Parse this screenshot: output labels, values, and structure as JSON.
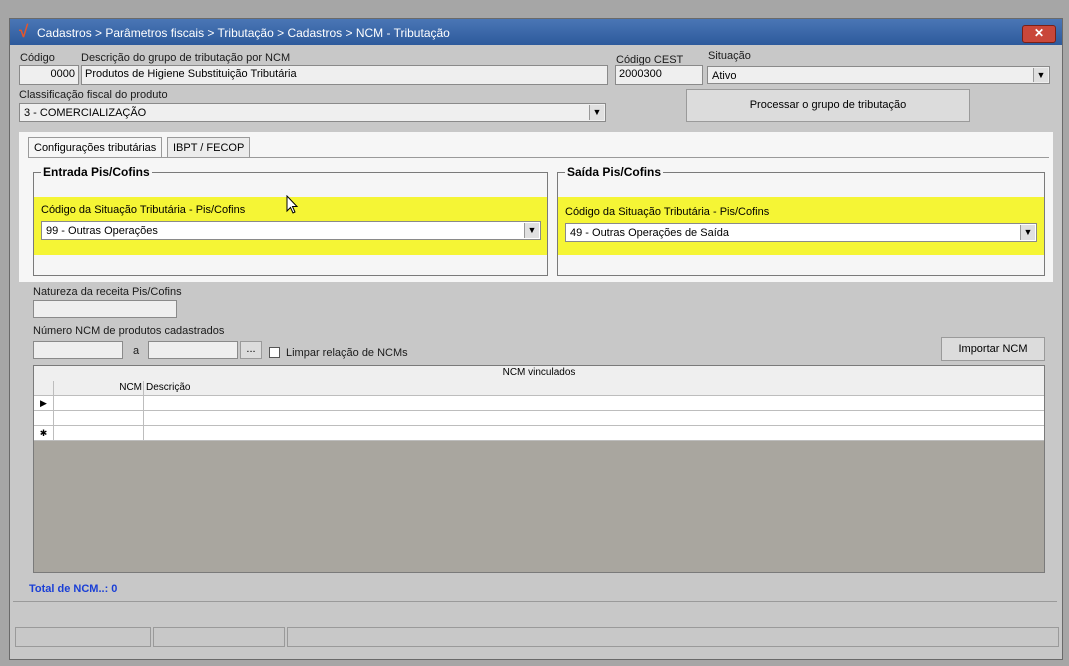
{
  "window": {
    "logo": "√",
    "title": "Cadastros > Parâmetros fiscais > Tributação > Cadastros > NCM - Tributação",
    "close_label": "✕"
  },
  "header": {
    "codigo_label": "Código",
    "codigo_value": "0000",
    "descricao_label": "Descrição do grupo de tributação por NCM",
    "descricao_value": "Produtos de Higiene Substituição Tributária",
    "cest_label": "Código CEST",
    "cest_value": "2000300",
    "situacao_label": "Situação",
    "situacao_value": "Ativo",
    "classificacao_label": "Classificação fiscal do produto",
    "classificacao_value": "3 - COMERCIALIZAÇÃO",
    "processar_label": "Processar o grupo de tributação"
  },
  "tabs": [
    {
      "label": "Configurações tributárias"
    },
    {
      "label": "IBPT / FECOP"
    }
  ],
  "entrada": {
    "title": "Entrada Pis/Cofins",
    "cst_label": "Código da Situação Tributária - Pis/Cofins",
    "cst_value": "99 -  Outras Operações"
  },
  "saida": {
    "title": "Saída Pis/Cofins",
    "cst_label": "Código da Situação Tributária - Pis/Cofins",
    "cst_value": "49 -  Outras Operações de Saída"
  },
  "natureza": {
    "label": "Natureza da receita Pis/Cofins",
    "value": ""
  },
  "ncm_range": {
    "label": "Número  NCM de produtos cadastrados",
    "from": "",
    "sep": "a",
    "to": "",
    "browse_label": "...",
    "clear_label": "Limpar relação de NCMs",
    "import_label": "Importar NCM"
  },
  "grid": {
    "title": "NCM vinculados",
    "columns": [
      "NCM",
      "Descrição"
    ],
    "row_indicators": [
      "▶",
      "",
      "✱"
    ]
  },
  "total_label": "Total de NCM..: 0",
  "colors": {
    "highlight": "#f5f535",
    "title_blue": "#2d5a9c",
    "total_blue": "#1a3fd6"
  }
}
